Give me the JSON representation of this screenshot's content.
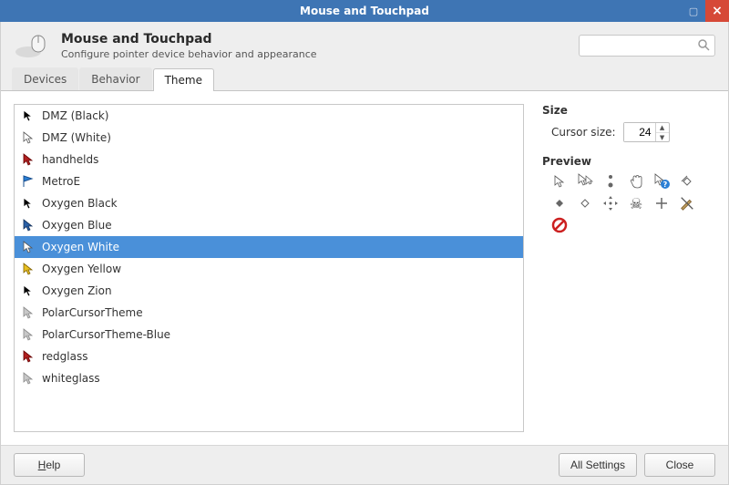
{
  "window": {
    "title": "Mouse and Touchpad"
  },
  "header": {
    "title": "Mouse and Touchpad",
    "subtitle": "Configure pointer device behavior and appearance",
    "search_placeholder": ""
  },
  "tabs": [
    {
      "label": "Devices",
      "active": false
    },
    {
      "label": "Behavior",
      "active": false
    },
    {
      "label": "Theme",
      "active": true
    }
  ],
  "themes": [
    {
      "name": "DMZ (Black)",
      "selected": false,
      "swatch": "black"
    },
    {
      "name": "DMZ (White)",
      "selected": false,
      "swatch": "white"
    },
    {
      "name": "handhelds",
      "selected": false,
      "swatch": "red"
    },
    {
      "name": "MetroE",
      "selected": false,
      "swatch": "blueflag"
    },
    {
      "name": "Oxygen Black",
      "selected": false,
      "swatch": "black"
    },
    {
      "name": "Oxygen Blue",
      "selected": false,
      "swatch": "blue"
    },
    {
      "name": "Oxygen White",
      "selected": true,
      "swatch": "white"
    },
    {
      "name": "Oxygen Yellow",
      "selected": false,
      "swatch": "yellow"
    },
    {
      "name": "Oxygen Zion",
      "selected": false,
      "swatch": "black"
    },
    {
      "name": "PolarCursorTheme",
      "selected": false,
      "swatch": "gray"
    },
    {
      "name": "PolarCursorTheme-Blue",
      "selected": false,
      "swatch": "gray"
    },
    {
      "name": "redglass",
      "selected": false,
      "swatch": "red"
    },
    {
      "name": "whiteglass",
      "selected": false,
      "swatch": "gray"
    }
  ],
  "size": {
    "section_title": "Size",
    "label": "Cursor size:",
    "value": "24"
  },
  "preview": {
    "section_title": "Preview",
    "icons": [
      "pointer",
      "pointer-copy",
      "diag-dots",
      "hand",
      "pointer-help",
      "diamond-split",
      "diamond",
      "single-diamond",
      "move",
      "skull",
      "plus",
      "pen-forbid",
      "forbidden"
    ]
  },
  "footer": {
    "help": "Help",
    "all_settings": "All Settings",
    "close": "Close"
  }
}
